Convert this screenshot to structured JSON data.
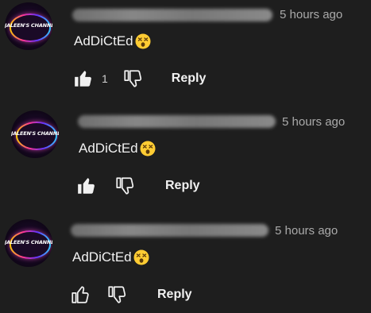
{
  "comments": [
    {
      "avatar_text": "JALEEN'S CHANNEL",
      "timestamp": "5 hours ago",
      "text": "AdDiCtEd",
      "emoji": "dizzy-face-emoji",
      "likes": "1",
      "liked": true,
      "reply_label": "Reply"
    },
    {
      "avatar_text": "JALEEN'S CHANNEL",
      "timestamp": "5 hours ago",
      "text": "AdDiCtEd",
      "emoji": "dizzy-face-emoji",
      "likes": "",
      "liked": true,
      "reply_label": "Reply"
    },
    {
      "avatar_text": "JALEEN'S CHANNEL",
      "timestamp": "5 hours ago",
      "text": "AdDiCtEd",
      "emoji": "dizzy-face-emoji",
      "likes": "",
      "liked": false,
      "reply_label": "Reply"
    }
  ],
  "colors": {
    "background": "#1e1e1e",
    "text": "#f1f1f1",
    "secondary_text": "#aaaaaa"
  }
}
